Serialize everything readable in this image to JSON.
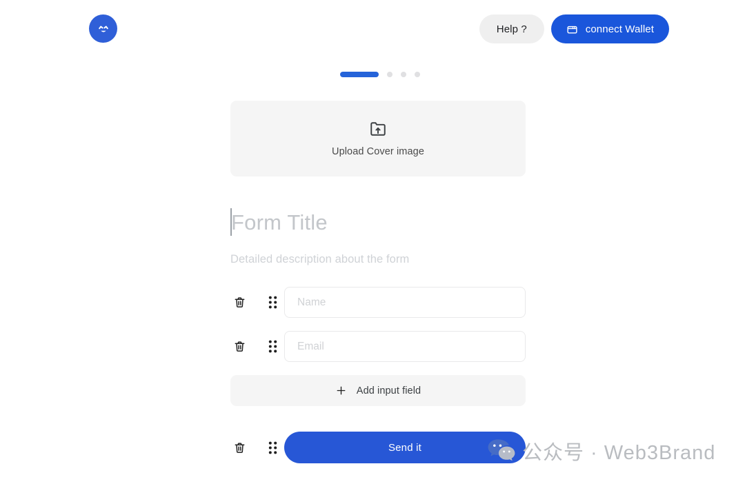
{
  "header": {
    "logo_icon": "smiley-arrows-logo-icon",
    "help_label": "Help ?",
    "wallet_label": "connect Wallet",
    "wallet_icon": "wallet-icon"
  },
  "progress": {
    "active_step": 1,
    "total_steps": 4,
    "active_color": "#2563d9",
    "inactive_color": "#e0e0e2"
  },
  "upload": {
    "icon": "folder-upload-icon",
    "label": "Upload Cover image"
  },
  "form": {
    "title_placeholder": "Form Title",
    "title_value": "",
    "description_placeholder": "Detailed description about the form",
    "description_value": "",
    "fields": [
      {
        "placeholder": "Name",
        "value": "",
        "delete_icon": "trash-icon",
        "drag_icon": "drag-handle-icon"
      },
      {
        "placeholder": "Email",
        "value": "",
        "delete_icon": "trash-icon",
        "drag_icon": "drag-handle-icon"
      }
    ],
    "add_field_label": "Add input field",
    "add_field_icon": "plus-icon",
    "send_label": "Send it",
    "send_delete_icon": "trash-icon",
    "send_drag_icon": "drag-handle-icon"
  },
  "watermark": {
    "icon": "wechat-icon",
    "text": "公众号 · Web3Brand"
  },
  "colors": {
    "brand_blue": "#1a56db",
    "send_blue": "#2757d6",
    "logo_blue": "#2f5fd8",
    "panel_gray": "#f5f5f5",
    "border_gray": "#e9e9ea"
  }
}
